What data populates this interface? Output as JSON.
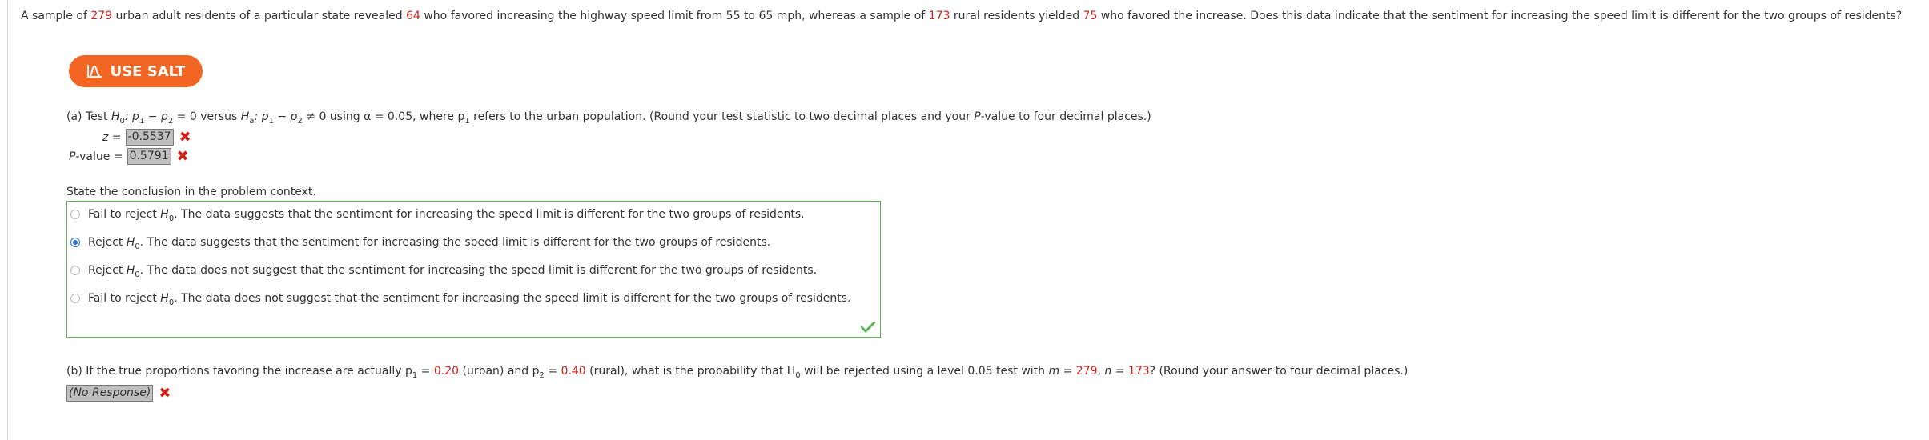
{
  "question": {
    "t1": "A sample of ",
    "n_urban": "279",
    "t2": " urban adult residents of a particular state revealed ",
    "x_urban": "64",
    "t3": " who favored increasing the highway speed limit from 55 to 65 mph, whereas a sample of ",
    "n_rural": "173",
    "t4": " rural residents yielded ",
    "x_rural": "75",
    "t5": " who favored the increase. Does this data indicate that the sentiment for increasing the speed limit is different for the two groups of residents?"
  },
  "salt_button": {
    "label": "USE SALT"
  },
  "part_a": {
    "prefix": "(a) Test ",
    "h0": "H",
    "h0_sub": "0",
    "h0_rest": ": p",
    "p1sub": "1",
    "minus1": " − p",
    "p2sub": "2",
    "eq0": " = 0 versus ",
    "ha": "H",
    "ha_sub": "a",
    "ha_rest": ": p",
    "p1sub_b": "1",
    "minus2": " − p",
    "p2sub_b": "2",
    "neq0": " ≠ 0 using α = 0.05, where p",
    "p1sub_c": "1",
    "tail": " refers to the urban population. (Round your test statistic to two decimal places and your ",
    "pvalue_word": "P",
    "tail2": "-value to four decimal places.)"
  },
  "z_row": {
    "label": "z = ",
    "value": "-0.5537"
  },
  "p_row": {
    "label_p": "P",
    "label_rest": "-value = ",
    "value": "0.5791"
  },
  "conclusion": {
    "label": "State the conclusion in the problem context.",
    "choices": [
      {
        "lead": "Fail to reject ",
        "h": "H",
        "sub": "0",
        "text": ". The data suggests that the sentiment for increasing the speed limit is different for the two groups of residents."
      },
      {
        "lead": "Reject ",
        "h": "H",
        "sub": "0",
        "text": ". The data suggests that the sentiment for increasing the speed limit is different for the two groups of residents."
      },
      {
        "lead": "Reject ",
        "h": "H",
        "sub": "0",
        "text": ". The data does not suggest that the sentiment for increasing the speed limit is different for the two groups of residents."
      },
      {
        "lead": "Fail to reject ",
        "h": "H",
        "sub": "0",
        "text": ". The data does not suggest that the sentiment for increasing the speed limit is different for the two groups of residents."
      }
    ],
    "selected_index": 1
  },
  "part_b": {
    "t1": "(b) If the true proportions favoring the increase are actually p",
    "s1": "1",
    "t2": " = ",
    "p1val": "0.20",
    "t3": " (urban) and p",
    "s2": "2",
    "t4": " = ",
    "p2val": "0.40",
    "t5": " (rural), what is the probability that H",
    "s3": "0",
    "t6": " will be rejected using a level 0.05 test with ",
    "mvar": "m",
    "t7": " = ",
    "mval": "279",
    "t8": ", ",
    "nvar": "n",
    "t9": " = ",
    "nval": "173",
    "t10": "? (Round your answer to four decimal places.)",
    "response": "(No Response)"
  },
  "colors": {
    "accent_orange": "#f26522",
    "error_red": "#d0211c",
    "correct_green": "#5db152",
    "radio_blue": "#2a72d4"
  }
}
